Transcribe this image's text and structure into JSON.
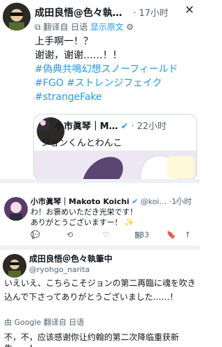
{
  "tweet_main": {
    "name": "成田良悟@色々執…",
    "time": "· 17小时",
    "close_icon": "×",
    "translated_from": "翻译自 日语",
    "show_original": "显示原文",
    "lines": [
      "上手啊一！？",
      "谢谢，谢谢……！！",
      "#偽典共鳴幻想スノーフィールド",
      "#FGO #ストレンジフェイク",
      "#strangeFake"
    ],
    "quote": {
      "name": "小市眞琴｜M…",
      "time": "· 22小时",
      "text": "ジョンくんとわんこ"
    }
  },
  "tweet_reply": {
    "name": "小市眞琴｜Makoto Koichi",
    "handle": "@koi… ·1小时",
    "lines": [
      "わ！お褒めいただき光栄です！",
      "ありがとうございますー！"
    ],
    "actions": {
      "reply_count": "1",
      "views_count": "533"
    }
  },
  "tweet_third": {
    "name": "成田良悟＠色々執筆中",
    "handle": "@ryohgo_narita",
    "body": "いえいえ、こちらこそジョンの第二再臨に魂を吹き込んで下さってありがとうございました……！",
    "google_label": "由 Google 翻译自 日语",
    "translation": "不，不，应该感谢你让约翰的第二次降临重获新生……！"
  },
  "colors": {
    "link": "#1d9bf0",
    "muted": "#536471",
    "verified": "#1d9bf0"
  }
}
